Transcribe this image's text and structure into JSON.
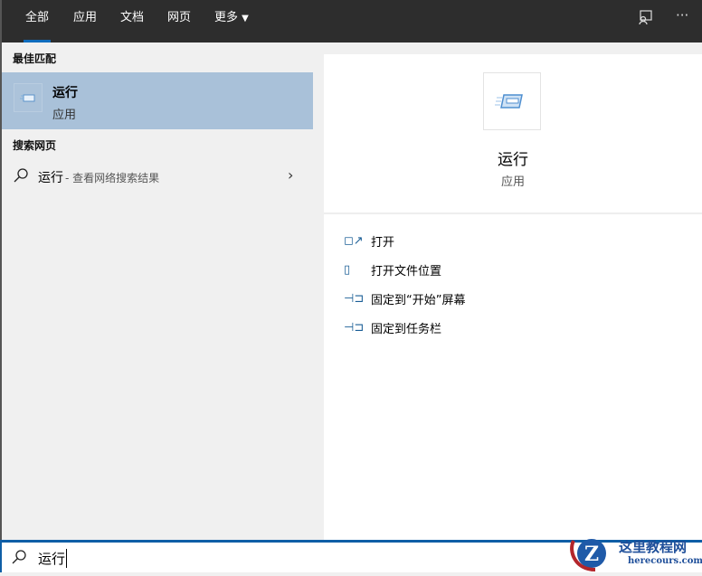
{
  "tabs": [
    {
      "label": "全部"
    },
    {
      "label": "应用"
    },
    {
      "label": "文档"
    },
    {
      "label": "网页"
    },
    {
      "label": "更多"
    }
  ],
  "left": {
    "best_match_heading": "最佳匹配",
    "best_match": {
      "title": "运行",
      "subtitle": "应用"
    },
    "web_heading": "搜索网页",
    "web_item": {
      "query": "运行",
      "suffix": " - 查看网络搜索结果"
    }
  },
  "right": {
    "title": "运行",
    "subtitle": "应用",
    "actions": [
      {
        "label": "打开"
      },
      {
        "label": "打开文件位置"
      },
      {
        "label": "固定到“开始”屏幕"
      },
      {
        "label": "固定到任务栏"
      }
    ]
  },
  "search": {
    "value": "运行"
  },
  "watermark": {
    "name": "这里教程网",
    "url": "herecours.com"
  }
}
